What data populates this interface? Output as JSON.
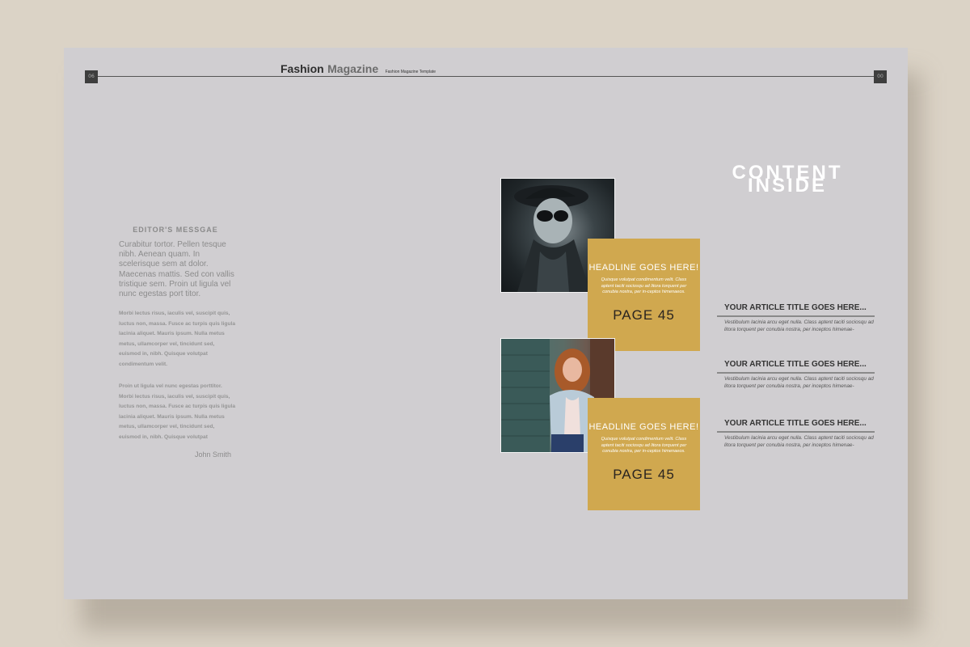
{
  "header": {
    "masthead_bold": "Fashion",
    "masthead_light": "Magazine",
    "masthead_sub": "Fashion Magazine Template",
    "page_left": "06",
    "page_right": "00"
  },
  "editor": {
    "title": "EDITOR'S MESSGAE",
    "lead": "Curabitur tortor. Pellen tesque nibh. Aenean quam. In scelerisque sem at dolor. Maecenas mattis. Sed con vallis tristique sem. Proin ut ligula vel nunc egestas port titor.",
    "body1": "Morbi lectus risus, iaculis vel, suscipit quis, luctus non, massa. Fusce ac turpis quis ligula lacinia aliquet. Mauris ipsum. Nulla metus metus, ullamcorper vel, tincidunt sed, euismod in, nibh. Quisque volutpat condimentum velit.",
    "body2": "Proin ut ligula vel nunc egestas porttitor. Morbi lectus risus, iaculis vel, suscipit quis, luctus non, massa. Fusce ac turpis quis ligula lacinia aliquet. Mauris ipsum. Nulla metus metus, ullamcorper vel, tincidunt sed, euismod in, nibh. Quisque volutpat",
    "signature": "John Smith"
  },
  "features": [
    {
      "headline": "HEADLINE GOES HERE!",
      "blurb": "Quisque volutpat condimentum velit. Class aptent taciti sociosqu ad litora torquent per conubia nostra, per in-ceptos himenaeos.",
      "page": "PAGE 45"
    },
    {
      "headline": "HEADLINE GOES HERE!",
      "blurb": "Quisque volutpat condimentum velit. Class aptent taciti sociosqu ad litora torquent per conubia nostra, per in-ceptos himenaeos.",
      "page": "PAGE 45"
    }
  ],
  "contents": {
    "title_line1": "CONTENT",
    "title_line2": "INSIDE",
    "articles": [
      {
        "title": "YOUR ARTICLE TITLE GOES HERE...",
        "body": "Vestibulum lacinia arcu eget nulla. Class aptent taciti sociosqu ad litora torquent per conubia nostra, per inceptos himenae-"
      },
      {
        "title": "YOUR ARTICLE TITLE GOES HERE...",
        "body": "Vestibulum lacinia arcu eget nulla. Class aptent taciti sociosqu ad litora torquent per conubia nostra, per inceptos himenae-"
      },
      {
        "title": "YOUR ARTICLE TITLE GOES HERE...",
        "body": "Vestibulum lacinia arcu eget nulla. Class aptent taciti sociosqu ad litora torquent per conubia nostra, per inceptos himenae-"
      }
    ]
  },
  "colors": {
    "background": "#dbd3c6",
    "page": "#d0ced1",
    "accent_gold": "#d0a84f"
  }
}
